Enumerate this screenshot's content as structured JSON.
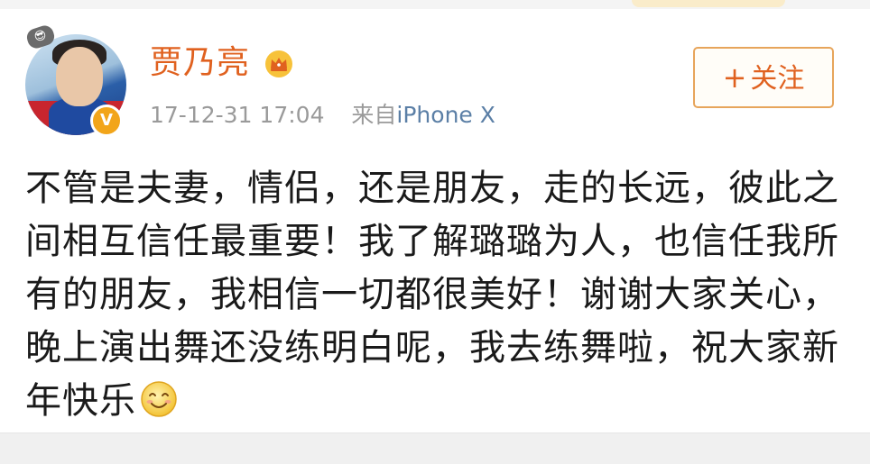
{
  "post": {
    "username": "贾乃亮",
    "timestamp": "17-12-31 17:04",
    "source_prefix": "来自",
    "source_device": "iPhone X",
    "follow_plus": "+",
    "follow_label": "关注",
    "content": "不管是夫妻，情侣，还是朋友，走的长远，彼此之间相互信任最重要！我了解璐璐为人，也信任我所有的朋友，我相信一切都很美好！谢谢大家关心，晚上演出舞还没练明白呢，我去练舞啦，祝大家新年快乐"
  },
  "icons": {
    "crown": "crown-icon",
    "verified": "verified-badge-icon",
    "emoji": "smile-emoji-icon",
    "avatar_badge": "sunglasses-badge-icon"
  },
  "colors": {
    "username": "#e0611f",
    "link": "#5b7fa6",
    "meta": "#9a9a9a",
    "follow_border": "#e7a55b",
    "verified": "#f2a51a"
  }
}
